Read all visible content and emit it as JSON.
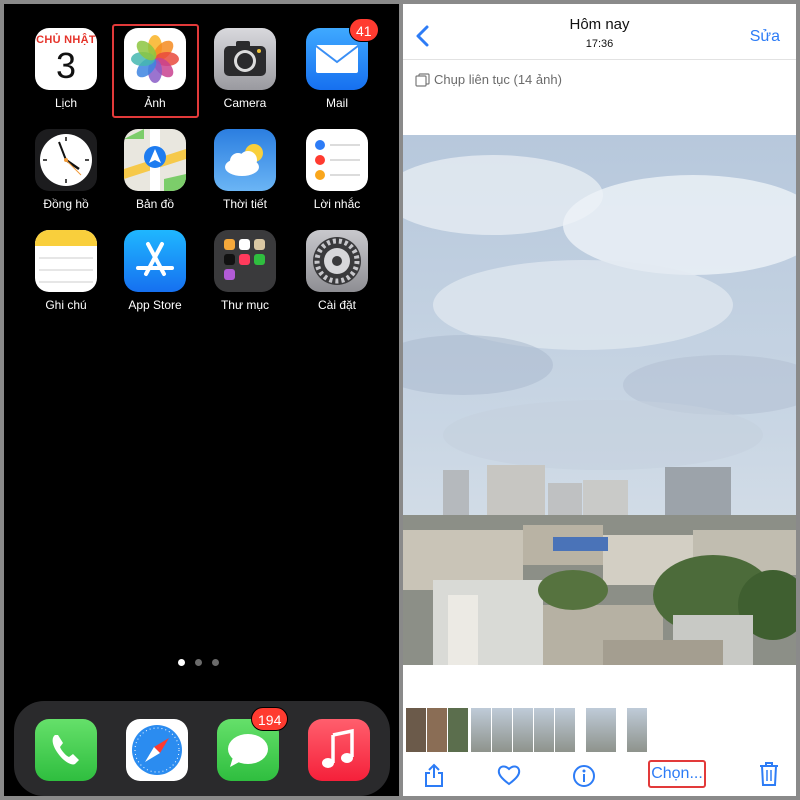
{
  "home": {
    "apps": [
      {
        "id": "calendar",
        "label": "Lịch",
        "day_name": "CHỦ NHẬT",
        "day_number": "3"
      },
      {
        "id": "photos",
        "label": "Ảnh"
      },
      {
        "id": "camera",
        "label": "Camera"
      },
      {
        "id": "mail",
        "label": "Mail",
        "badge": "41"
      },
      {
        "id": "clock",
        "label": "Đồng hồ"
      },
      {
        "id": "maps",
        "label": "Bản đồ"
      },
      {
        "id": "weather",
        "label": "Thời tiết"
      },
      {
        "id": "reminders",
        "label": "Lời nhắc"
      },
      {
        "id": "notes",
        "label": "Ghi chú"
      },
      {
        "id": "appstore",
        "label": "App Store"
      },
      {
        "id": "folder",
        "label": "Thư mục"
      },
      {
        "id": "settings",
        "label": "Cài đặt"
      }
    ],
    "dock": {
      "messages_badge": "194"
    }
  },
  "photos": {
    "title": "Hôm nay",
    "time": "17:36",
    "edit_label": "Sửa",
    "burst_label": "Chụp liên tục (14 ảnh)",
    "select_label": "Chọn..."
  },
  "colors": {
    "accent": "#2d7cf6",
    "highlight": "#e23a3a",
    "badge": "#ff3b30"
  }
}
